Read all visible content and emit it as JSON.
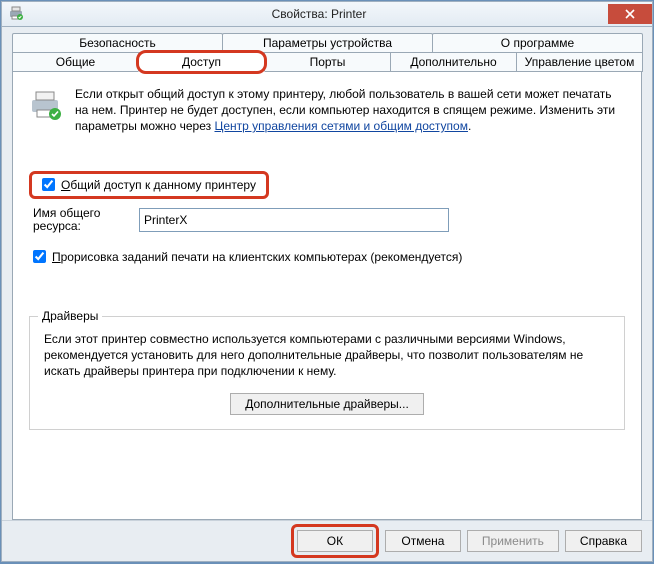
{
  "title": "Свойства: Printer",
  "tabs": {
    "row1": [
      "Безопасность",
      "Параметры устройства",
      "О программе"
    ],
    "row2": [
      "Общие",
      "Доступ",
      "Порты",
      "Дополнительно",
      "Управление цветом"
    ],
    "active": "Доступ"
  },
  "intro": {
    "text_a": "Если открыт общий доступ к этому принтеру, любой пользователь в вашей сети может печатать на нем. Принтер не будет доступен, если компьютер находится в спящем режиме. Изменить эти параметры можно через ",
    "link": "Центр управления сетями и общим доступом",
    "text_b": "."
  },
  "share": {
    "checkbox_label_prefix": "О",
    "checkbox_label_rest": "бщий доступ к данному принтеру",
    "checked": true,
    "sharename_label": "Имя общего ресурса:",
    "sharename_value": "PrinterX"
  },
  "render": {
    "label_prefix": "П",
    "label_rest": "рорисовка заданий печати на клиентских компьютерах (рекомендуется)",
    "checked": true
  },
  "drivers": {
    "legend": "Драйверы",
    "text": "Если этот принтер совместно используется компьютерами с различными версиями Windows, рекомендуется установить для него дополнительные драйверы, что позволит пользователям не искать драйверы принтера при подключении к нему.",
    "button": "Дополнительные драйверы..."
  },
  "buttons": {
    "ok": "ОК",
    "cancel": "Отмена",
    "apply": "Применить",
    "help": "Справка"
  }
}
